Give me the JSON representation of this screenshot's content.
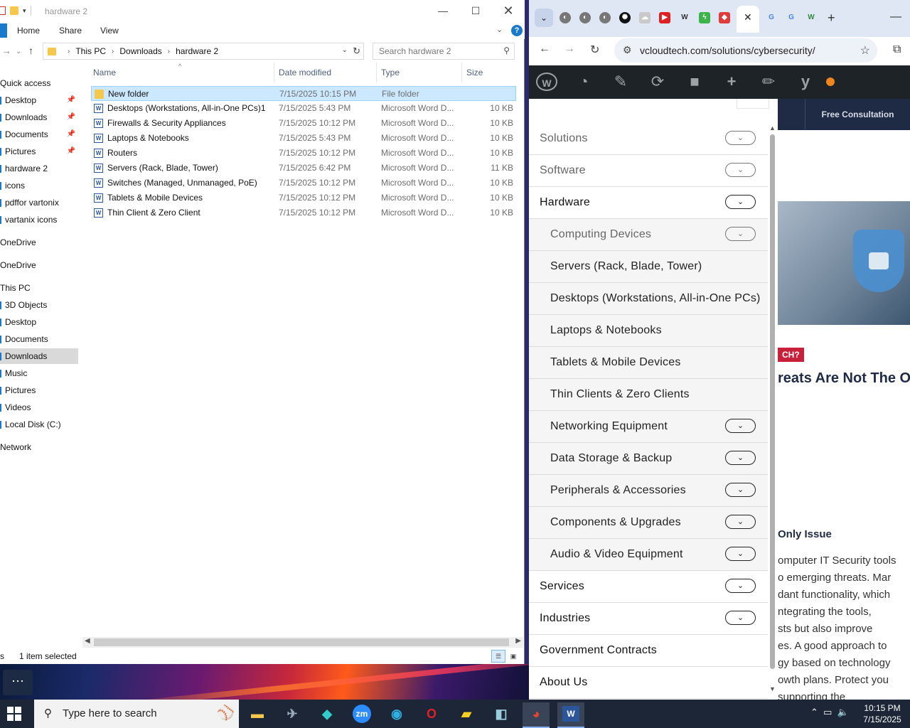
{
  "explorer": {
    "title": "hardware 2",
    "ribbon_tabs": [
      "Home",
      "Share",
      "View"
    ],
    "address": [
      "This PC",
      "Downloads",
      "hardware 2"
    ],
    "search_placeholder": "Search hardware 2",
    "columns": {
      "name": "Name",
      "date": "Date modified",
      "type": "Type",
      "size": "Size"
    },
    "nav": [
      {
        "label": "Quick access",
        "pin": false
      },
      {
        "label": "Desktop",
        "pin": true
      },
      {
        "label": "Downloads",
        "pin": true
      },
      {
        "label": "Documents",
        "pin": true
      },
      {
        "label": "Pictures",
        "pin": true
      },
      {
        "label": "hardware 2",
        "pin": false
      },
      {
        "label": "icons",
        "pin": false
      },
      {
        "label": "pdffor vartonix",
        "pin": false
      },
      {
        "label": "vartanix icons",
        "pin": false
      },
      {
        "label": "OneDrive",
        "pin": false
      },
      {
        "label": "OneDrive",
        "pin": false
      },
      {
        "label": "This PC",
        "pin": false
      },
      {
        "label": "3D Objects",
        "pin": false
      },
      {
        "label": "Desktop",
        "pin": false
      },
      {
        "label": "Documents",
        "pin": false
      },
      {
        "label": "Downloads",
        "pin": false
      },
      {
        "label": "Music",
        "pin": false
      },
      {
        "label": "Pictures",
        "pin": false
      },
      {
        "label": "Videos",
        "pin": false
      },
      {
        "label": "Local Disk (C:)",
        "pin": false
      },
      {
        "label": "Network",
        "pin": false
      }
    ],
    "files": [
      {
        "name": "New folder",
        "date": "7/15/2025 10:15 PM",
        "type": "File folder",
        "size": "",
        "kind": "folder"
      },
      {
        "name": "Desktops (Workstations, All-in-One PCs)1",
        "date": "7/15/2025 5:43 PM",
        "type": "Microsoft Word D...",
        "size": "10 KB",
        "kind": "doc"
      },
      {
        "name": "Firewalls & Security Appliances",
        "date": "7/15/2025 10:12 PM",
        "type": "Microsoft Word D...",
        "size": "10 KB",
        "kind": "doc"
      },
      {
        "name": "Laptops & Notebooks",
        "date": "7/15/2025 5:43 PM",
        "type": "Microsoft Word D...",
        "size": "10 KB",
        "kind": "doc"
      },
      {
        "name": "Routers",
        "date": "7/15/2025 10:12 PM",
        "type": "Microsoft Word D...",
        "size": "10 KB",
        "kind": "doc"
      },
      {
        "name": "Servers (Rack, Blade, Tower)",
        "date": "7/15/2025 6:42 PM",
        "type": "Microsoft Word D...",
        "size": "11 KB",
        "kind": "doc"
      },
      {
        "name": "Switches (Managed, Unmanaged, PoE)",
        "date": "7/15/2025 10:12 PM",
        "type": "Microsoft Word D...",
        "size": "10 KB",
        "kind": "doc"
      },
      {
        "name": "Tablets & Mobile Devices",
        "date": "7/15/2025 10:12 PM",
        "type": "Microsoft Word D...",
        "size": "10 KB",
        "kind": "doc"
      },
      {
        "name": "Thin Client & Zero Client",
        "date": "7/15/2025 10:12 PM",
        "type": "Microsoft Word D...",
        "size": "10 KB",
        "kind": "doc"
      }
    ],
    "status": "1 item selected",
    "status_prefix": "s"
  },
  "browser": {
    "url": "vcloudtech.com/solutions/cybersecurity/",
    "site": {
      "cta": "Free Consultation",
      "badge": "CH?",
      "headline": "reats Are Not The O",
      "subhead": "Only Issue",
      "para": [
        "omputer IT Security tools",
        "o emerging threats. Mar",
        "dant functionality, which",
        "ntegrating the tools,",
        "sts but also improve",
        "es. A good approach to",
        "gy based on technology",
        "owth plans. Protect you",
        "supporting the"
      ]
    },
    "menu": [
      {
        "label": "Solutions",
        "level": "top",
        "chev": true,
        "muted": true
      },
      {
        "label": "Software",
        "level": "top",
        "chev": true,
        "muted": true
      },
      {
        "label": "Hardware",
        "level": "top",
        "chev": true,
        "muted": false
      },
      {
        "label": "Computing Devices",
        "level": "sub",
        "chev": true,
        "muted": true
      },
      {
        "label": "Servers (Rack, Blade, Tower)",
        "level": "sub",
        "chev": false,
        "muted": false
      },
      {
        "label": "Desktops (Workstations, All-in-One PCs)",
        "level": "sub",
        "chev": false,
        "muted": false
      },
      {
        "label": "Laptops & Notebooks",
        "level": "sub",
        "chev": false,
        "muted": false
      },
      {
        "label": "Tablets & Mobile Devices",
        "level": "sub",
        "chev": false,
        "muted": false
      },
      {
        "label": "Thin Clients & Zero Clients",
        "level": "sub",
        "chev": false,
        "muted": false
      },
      {
        "label": "Networking Equipment",
        "level": "sub",
        "chev": true,
        "muted": false
      },
      {
        "label": "Data Storage & Backup",
        "level": "sub",
        "chev": true,
        "muted": false
      },
      {
        "label": "Peripherals & Accessories",
        "level": "sub",
        "chev": true,
        "muted": false
      },
      {
        "label": "Components & Upgrades",
        "level": "sub",
        "chev": true,
        "muted": false
      },
      {
        "label": "Audio & Video Equipment",
        "level": "sub",
        "chev": true,
        "muted": false
      },
      {
        "label": "Services",
        "level": "top",
        "chev": true,
        "muted": false
      },
      {
        "label": "Industries",
        "level": "top",
        "chev": true,
        "muted": false
      },
      {
        "label": "Government Contracts",
        "level": "top",
        "chev": false,
        "muted": false
      },
      {
        "label": "About Us",
        "level": "top",
        "chev": false,
        "muted": false
      }
    ]
  },
  "taskbar": {
    "search_placeholder": "Type here to search",
    "time": "10:15 PM",
    "date": "7/15/2025"
  },
  "colors": {
    "accent": "#1979ca",
    "selection": "#cce8ff",
    "wp_bar": "#1d2327",
    "site_dark": "#1f2a44",
    "badge": "#c8203a"
  }
}
